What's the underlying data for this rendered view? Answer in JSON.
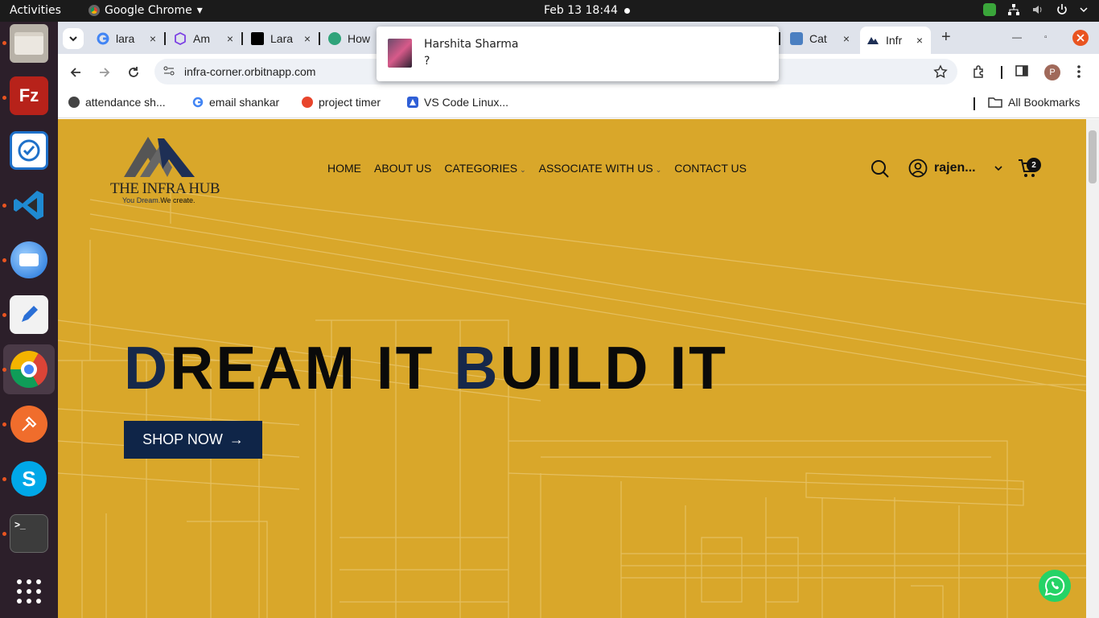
{
  "system": {
    "activities": "Activities",
    "app_name": "Google Chrome",
    "app_menu_arrow": "▾",
    "clock": "Feb 13  18:44"
  },
  "dock": {
    "apps": [
      "files",
      "filezilla",
      "tracker",
      "vscode",
      "thunderbird",
      "text-editor",
      "chrome",
      "postman",
      "skype",
      "terminal",
      "app-grid"
    ]
  },
  "tabs": [
    {
      "label": "lara",
      "favicon": "google-icon"
    },
    {
      "label": "Am",
      "favicon": "cube-icon"
    },
    {
      "label": "Lara",
      "favicon": "medium-icon"
    },
    {
      "label": "How",
      "favicon": "dollar-icon"
    },
    {
      "label": "Cat",
      "favicon": "location-icon"
    },
    {
      "label": "Infr",
      "favicon": "infra-icon",
      "active": true
    }
  ],
  "tab_controls": {
    "new_tab": "+",
    "close": "×"
  },
  "toolbar": {
    "url": "infra-corner.orbitnapp.com",
    "profile_initial": "P"
  },
  "bookmarks": [
    {
      "label": "attendance sh...",
      "color": "#444444"
    },
    {
      "label": "email shankar",
      "color": "#4285f4"
    },
    {
      "label": "project timer",
      "color": "#e8452c"
    },
    {
      "label": "VS Code Linux...",
      "color": "#2f5fd6"
    }
  ],
  "all_bookmarks": "All Bookmarks",
  "site": {
    "logo_title": "THE INFRA HUB",
    "logo_tagline_a": "You Dream.",
    "logo_tagline_b": "We create.",
    "nav": [
      "HOME",
      "ABOUT US",
      "CATEGORIES",
      "ASSOCIATE WITH US",
      "CONTACT US"
    ],
    "user_name": "rajen...",
    "cart_count": "2",
    "hero_part1_accent": "D",
    "hero_part1_rest": "REAM IT ",
    "hero_part2_accent": "B",
    "hero_part2_rest": "UILD IT",
    "shop_button": "SHOP NOW",
    "shop_arrow": "→"
  },
  "notification": {
    "sender": "Harshita Sharma",
    "message": "?"
  },
  "colors": {
    "page_bg": "#d9a72a",
    "brand_navy": "#0f2548",
    "ubuntu_orange": "#e95420"
  }
}
